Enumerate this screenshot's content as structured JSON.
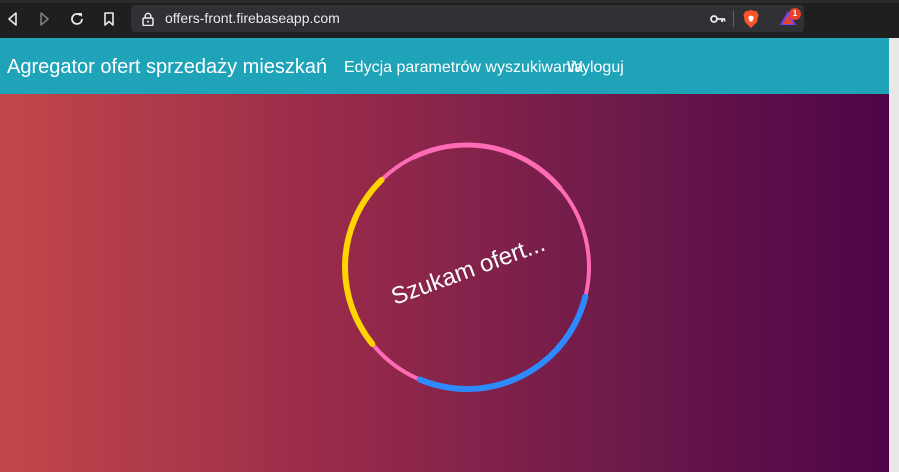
{
  "browser": {
    "url": "offers-front.firebaseapp.com",
    "icons": [
      "back-icon",
      "forward-icon",
      "reload-icon",
      "bookmark-icon",
      "lock-icon",
      "key-icon",
      "brave-shields-icon",
      "brave-rewards-icon"
    ],
    "rewards_badge": "1"
  },
  "app": {
    "brand": "Agregator ofert sprzedaży mieszkań",
    "nav": {
      "edit_search": "Edycja parametrów wyszukiwania",
      "logout": "Wyloguj"
    },
    "hero": {
      "loading_text": "Szukam ofert..."
    }
  },
  "colors": {
    "appbar": "#1ea3b8",
    "gradient_start": "#c2474a",
    "gradient_end": "#4d0448",
    "ring_pink": "#ff6bb5",
    "ring_yellow": "#ffd400",
    "ring_blue": "#2e8bff"
  }
}
